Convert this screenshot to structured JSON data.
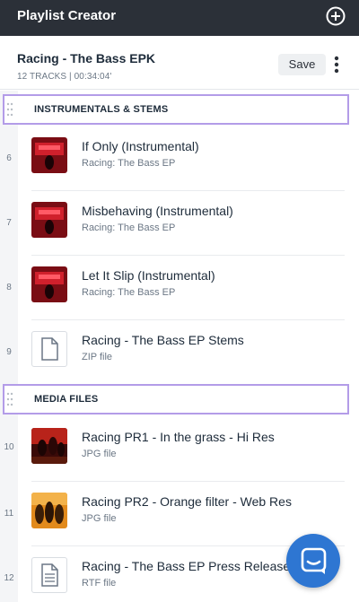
{
  "app": {
    "title": "Playlist Creator"
  },
  "playlist": {
    "title": "Racing - The Bass EPK",
    "meta": "12 TRACKS | 00:34:04'",
    "save_label": "Save"
  },
  "sections": [
    {
      "label": "INSTRUMENTALS & STEMS"
    },
    {
      "label": "MEDIA FILES"
    }
  ],
  "tracks": [
    {
      "num": "6",
      "title": "If Only (Instrumental)",
      "subtitle": "Racing: The Bass EP",
      "thumb": "album-art-icon"
    },
    {
      "num": "7",
      "title": "Misbehaving (Instrumental)",
      "subtitle": "Racing: The Bass EP",
      "thumb": "album-art-icon"
    },
    {
      "num": "8",
      "title": "Let It Slip (Instrumental)",
      "subtitle": "Racing: The Bass EP",
      "thumb": "album-art-icon"
    },
    {
      "num": "9",
      "title": "Racing - The Bass EP Stems",
      "subtitle": "ZIP file",
      "thumb": "file-icon"
    },
    {
      "num": "10",
      "title": "Racing PR1 - In the grass - Hi Res",
      "subtitle": "JPG file",
      "thumb": "photo-icon"
    },
    {
      "num": "11",
      "title": "Racing PR2 - Orange filter - Web Res",
      "subtitle": "JPG file",
      "thumb": "photo-icon"
    },
    {
      "num": "12",
      "title": "Racing - The Bass EP Press Release te",
      "subtitle": "RTF file",
      "thumb": "document-icon"
    }
  ],
  "colors": {
    "topbar": "#2b3038",
    "section_border": "#b39ce8",
    "chat_button": "#2e76d2",
    "album_art": "#b3121c"
  }
}
